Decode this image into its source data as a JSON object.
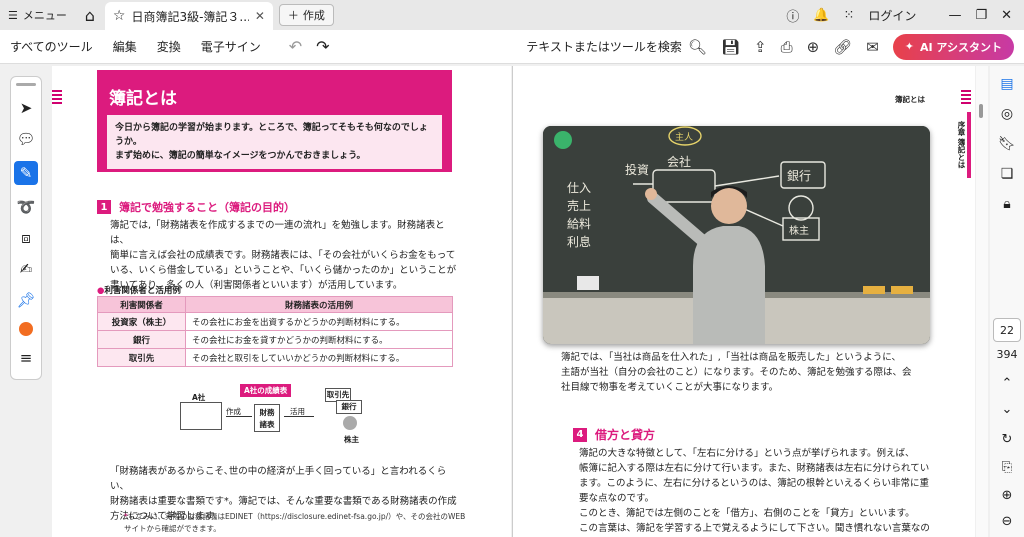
{
  "titlebar": {
    "menu_label": "メニュー",
    "tab_title": "日商簿記3級-簿記３...",
    "newtab_label": "作成",
    "login_label": "ログイン"
  },
  "toolbar": {
    "items": [
      "すべてのツール",
      "編集",
      "変換",
      "電子サイン"
    ],
    "search_label": "テキストまたはツールを検索",
    "ai_label": "AI アシスタント"
  },
  "left_page": {
    "header_title": "簿記とは",
    "header_box_line1": "今日から簿記の学習が始まります。ところで、簿記ってそもそも何なのでしょうか。",
    "header_box_line2": "まず始めに、簿記の簡単なイメージをつかんでおきましょう。",
    "section1_num": "1",
    "section1_title": "簿記で勉強すること（簿記の目的）",
    "para1": [
      "簿記では,「財務諸表を作成するまでの一連の流れ」を勉強します。財務諸表とは、",
      "簡単に言えば会社の成績表です。財務諸表には、「その会社がいくらお金をもって",
      "いる、いくら借金している」ということや、「いくら儲かったのか」ということが",
      "書いてあり、多くの人（利害関係者といいます）が活用しています。"
    ],
    "table_title": "利害関係者と活用例",
    "table_headers": [
      "利害関係者",
      "財務諸表の活用例"
    ],
    "table_rows": [
      [
        "投資家（株主）",
        "その会社にお金を出資するかどうかの判断材料にする。"
      ],
      [
        "銀行",
        "その会社にお金を貸すかどうかの判断材料にする。"
      ],
      [
        "取引先",
        "その会社と取引をしていいかどうかの判断材料にする。"
      ]
    ],
    "diagram": {
      "company": "A社",
      "report_tag": "A社の成績表",
      "create": "作成",
      "statements_line1": "財務",
      "statements_line2": "諸表",
      "use": "活用",
      "partner": "取引先",
      "bank": "銀行",
      "shareholder": "株主"
    },
    "para2": [
      "「財務諸表があるからこそ､世の中の経済が上手く回っている」と言われるくらい、",
      "財務諸表は重要な書類です*。簿記では、そんな重要な書類である財務諸表の作成",
      "方法について学習します。"
    ],
    "footnote_line1": "ちなみに、実際の財務諸表はEDINET（https://disclosure.edinet-fsa.go.jp/）や、その会社のWEB",
    "footnote_line2": "サイトから確認ができます。"
  },
  "right_page": {
    "running_header": "簿記とは",
    "side_tab": "序章 簿記とは",
    "para1": [
      "簿記では、「当社は商品を仕入れた」,「当社は商品を販売した」というように、",
      "主語が当社（自分の会社のこと）になります。そのため、簿記を勉強する際は、会",
      "社目線で物事を考えていくことが大事になります。"
    ],
    "section4_num": "4",
    "section4_title": "借方と貸方",
    "para2": [
      "簿記の大きな特徴として、「左右に分ける」という点が挙げられます。例えば、",
      "帳簿に記入する際は左右に分けて行います。また、財務諸表は左右に分けられてい",
      "ます。このように、左右に分けるというのは、簿記の根幹といえるくらい非常に重",
      "要な点なのです。",
      "このとき、簿記では左側のことを「借方」、右側のことを「貸方」といいます。",
      "この言葉は、簿記を学習する上で覚えるようにして下さい。聞き慣れない言葉なの"
    ]
  },
  "video": {
    "board_words": [
      "主人",
      "会社",
      "投資",
      "銀行",
      "株主",
      "仕入",
      "売上",
      "給料",
      "利息"
    ]
  },
  "nav": {
    "current_page": "22",
    "total_pages": "394"
  },
  "colors": {
    "brand_pink": "#dc1b7e",
    "ai_gradient_start": "#e8414a",
    "ai_gradient_end": "#c73aa5"
  }
}
